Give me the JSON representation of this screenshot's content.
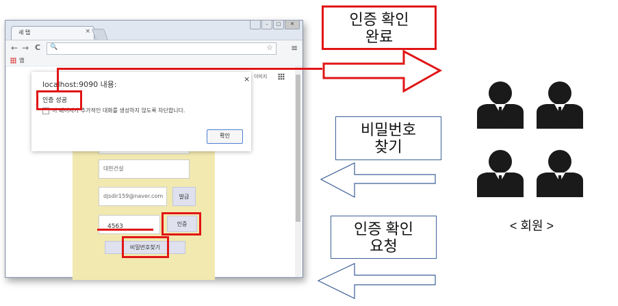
{
  "browser": {
    "tab_title": "새 탭",
    "tab_close": "×",
    "bookmarks_apps": "앱",
    "google_images": "이미지",
    "nav": {
      "back": "←",
      "forward": "→",
      "reload": "C"
    }
  },
  "form": {
    "company": "대한건설",
    "email": "djsdir159@naver.com",
    "issue_button": "발급",
    "code": "4563",
    "verify_button": "인증",
    "find_password_button": "비밀번호찾기"
  },
  "dialog": {
    "title": "localhost:9090 내용:",
    "message": "인증 성공",
    "checkbox_label": "이 페이지가 추가적인 대화를 생성하지 않도록 차단합니다.",
    "ok_button": "확인",
    "close": "×"
  },
  "labels": {
    "verify_complete": [
      "인증 확인",
      "완료"
    ],
    "find_password": [
      "비밀번호",
      "찾기"
    ],
    "verify_request": [
      "인증 확인",
      "요청"
    ],
    "members": "< 회원 >"
  },
  "colors": {
    "highlight_red": "#e01515",
    "arrow_blue": "#3b5f96",
    "panel_yellow": "#f1e9b0"
  },
  "icons": [
    "search-icon",
    "star-icon",
    "menu-icon",
    "apps-icon",
    "grid-icon",
    "person-icon",
    "checkbox-icon"
  ]
}
